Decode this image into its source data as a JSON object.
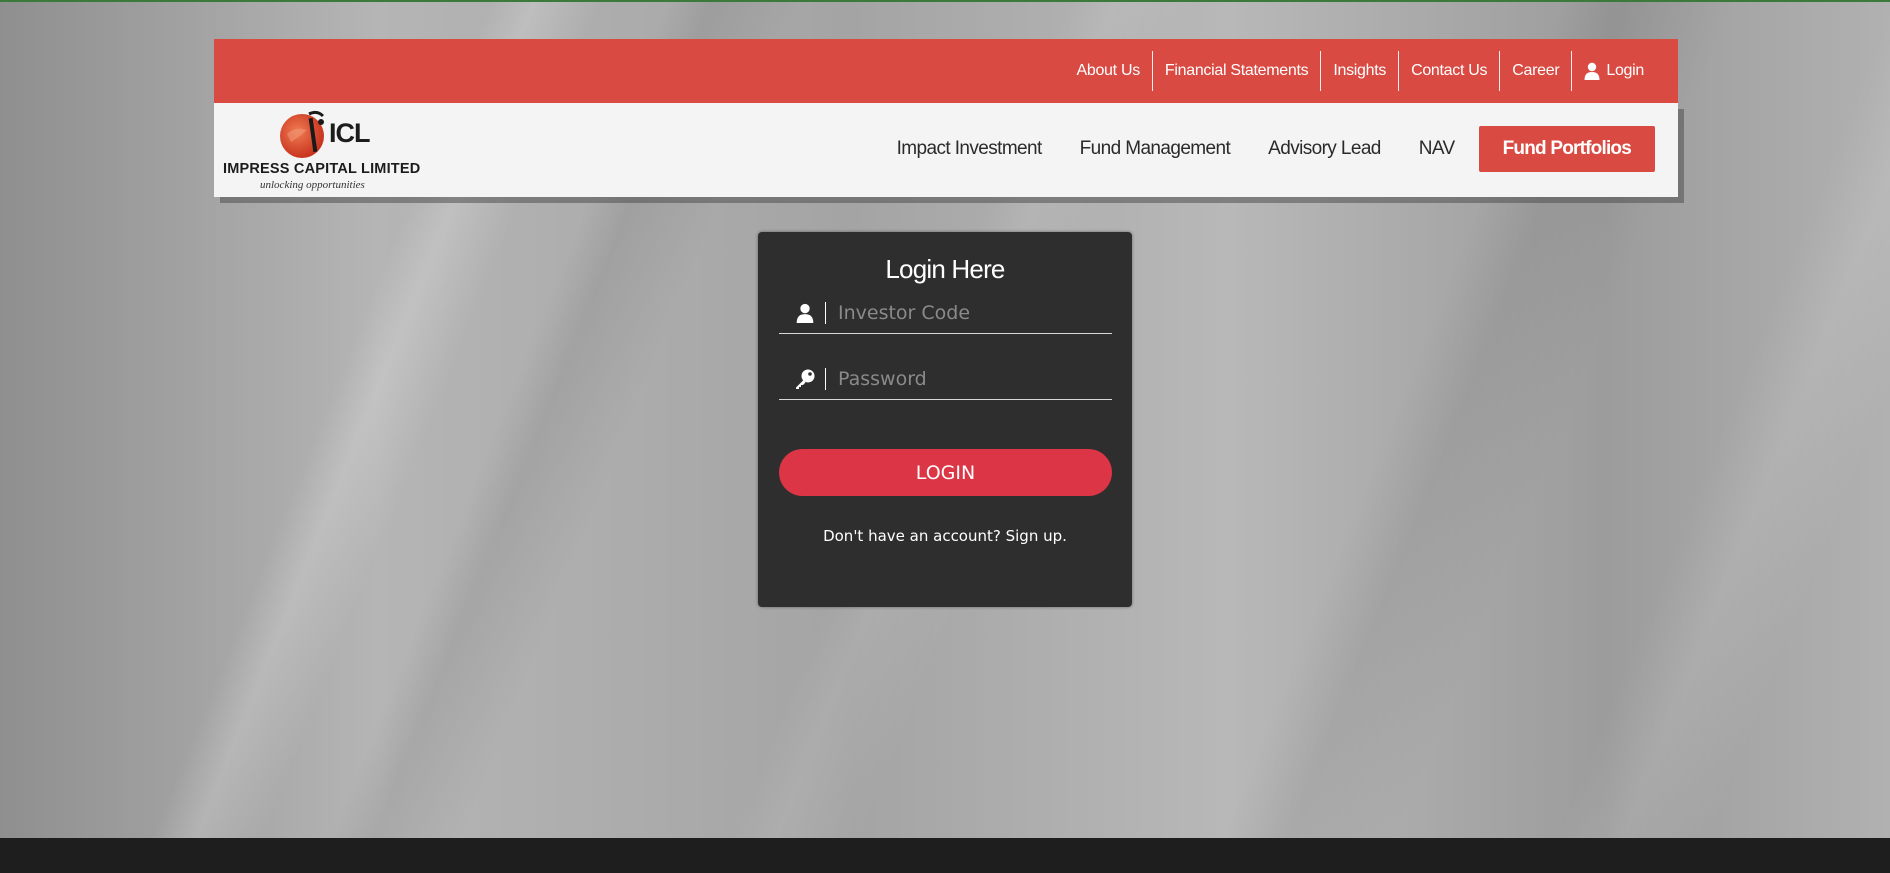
{
  "brand": {
    "logo_letters": "ICL",
    "name": "IMPRESS CAPITAL LIMITED",
    "tagline": "unlocking opportunities"
  },
  "topbar": {
    "items": [
      {
        "label": "About Us"
      },
      {
        "label": "Financial Statements"
      },
      {
        "label": "Insights"
      },
      {
        "label": "Contact Us"
      },
      {
        "label": "Career"
      },
      {
        "label": "Login",
        "icon": "user-icon"
      }
    ]
  },
  "nav": {
    "items": [
      {
        "label": "Impact Investment"
      },
      {
        "label": "Fund Management"
      },
      {
        "label": "Advisory Lead"
      },
      {
        "label": "NAV"
      }
    ],
    "cta_label": "Fund Portfolios"
  },
  "login": {
    "title": "Login Here",
    "investor_code_placeholder": "Investor Code",
    "investor_code_icon": "user-icon",
    "password_placeholder": "Password",
    "password_icon": "key-icon",
    "button_label": "LOGIN",
    "signup_text": "Don't have an account? Sign up."
  },
  "colors": {
    "accent_red": "#d94a43",
    "button_red": "#dc3545",
    "card_bg": "#2e2e2e"
  }
}
